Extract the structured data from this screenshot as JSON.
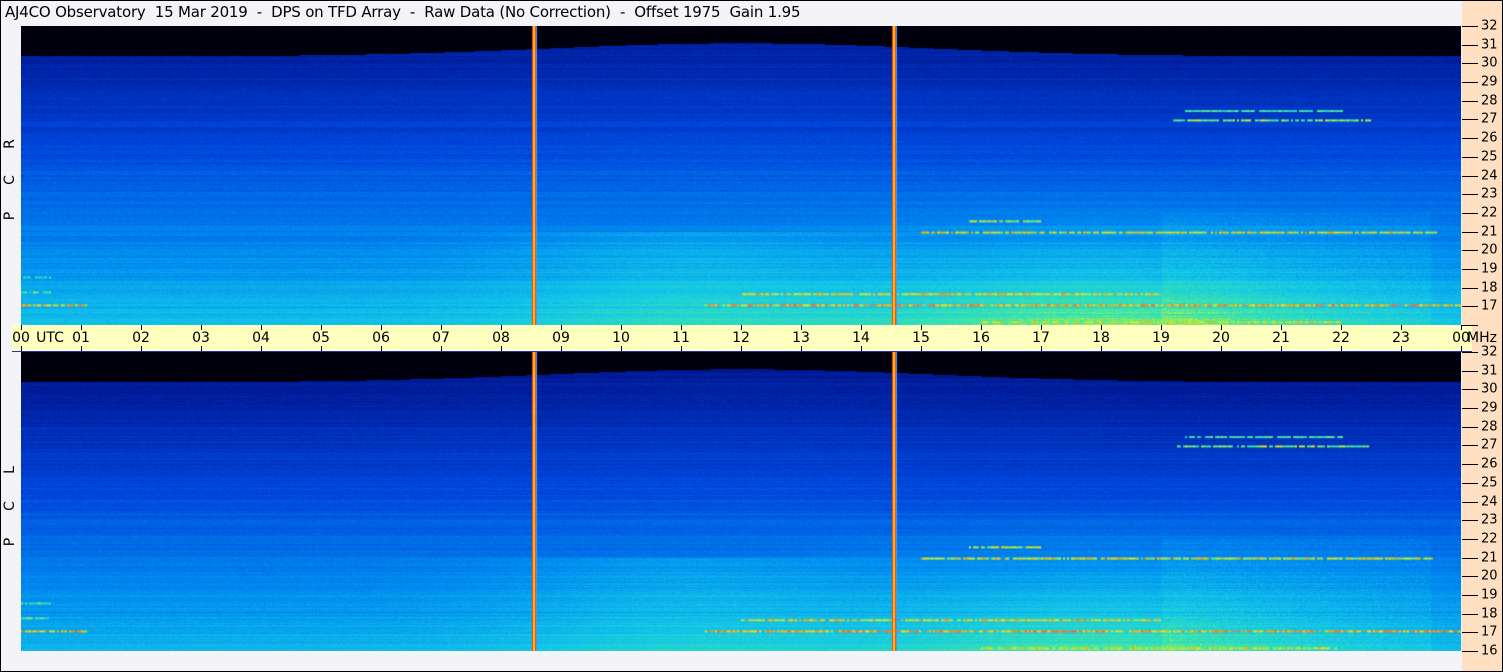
{
  "title": "AJ4CO Observatory  15 Mar 2019  -  DPS on TFD Array  -  Raw Data (No Correction)  -  Offset 1975  Gain 1.95",
  "chart_data": {
    "type": "heatmap",
    "title": "AJ4CO Observatory  15 Mar 2019  -  DPS on TFD Array  -  Raw Data (No Correction)  -  Offset 1975  Gain 1.95",
    "xlabel": "UTC",
    "ylabel": "MHz",
    "xlim": [
      0,
      24
    ],
    "ylim": [
      16,
      32
    ],
    "x_ticks": [
      "00",
      "01",
      "02",
      "03",
      "04",
      "05",
      "06",
      "07",
      "08",
      "09",
      "10",
      "11",
      "12",
      "13",
      "14",
      "15",
      "16",
      "17",
      "18",
      "19",
      "20",
      "21",
      "22",
      "23",
      "00"
    ],
    "x_unit_label": "UTC",
    "y_unit_label": "MHz",
    "y_ticks": [
      32,
      31,
      30,
      29,
      28,
      27,
      26,
      25,
      24,
      23,
      22,
      21,
      20,
      19,
      18,
      17,
      16
    ],
    "panels": [
      {
        "name": "RCP",
        "letters": [
          "R",
          "C",
          "P"
        ]
      },
      {
        "name": "LCP",
        "letters": [
          "L",
          "C",
          "P"
        ]
      }
    ],
    "vertical_markers_utc": [
      8.55,
      14.55
    ],
    "horizontal_streaks": [
      {
        "mhz": 17.1,
        "t0": 11.4,
        "t1": 24,
        "level": 0.9
      },
      {
        "mhz": 17.1,
        "t0": 0,
        "t1": 1.1,
        "level": 0.88
      },
      {
        "mhz": 17.7,
        "t0": 12.0,
        "t1": 19.0,
        "level": 0.87
      },
      {
        "mhz": 17.8,
        "t0": 0,
        "t1": 0.5,
        "level": 0.8
      },
      {
        "mhz": 21.0,
        "t0": 15.0,
        "t1": 23.6,
        "level": 0.86
      },
      {
        "mhz": 21.6,
        "t0": 15.8,
        "t1": 17.0,
        "level": 0.84
      },
      {
        "mhz": 27.0,
        "t0": 19.2,
        "t1": 22.5,
        "level": 0.82
      },
      {
        "mhz": 27.5,
        "t0": 19.4,
        "t1": 22.0,
        "level": 0.78
      },
      {
        "mhz": 16.2,
        "t0": 16.0,
        "t1": 22.0,
        "level": 0.85
      },
      {
        "mhz": 18.6,
        "t0": 0,
        "t1": 0.5,
        "level": 0.78
      }
    ]
  }
}
